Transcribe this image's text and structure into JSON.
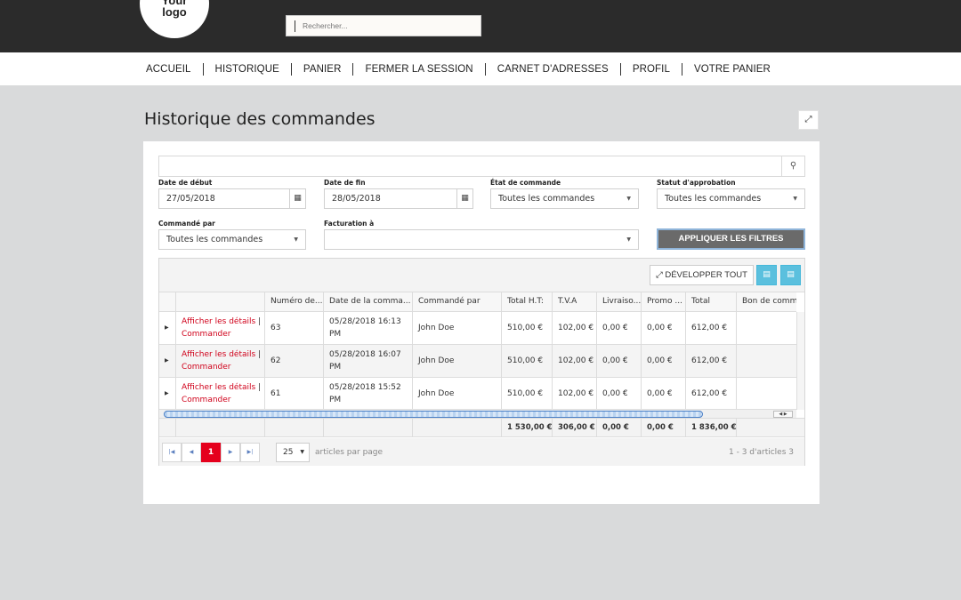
{
  "header": {
    "logo_line1": "Your",
    "logo_line2": "logo",
    "search_placeholder": "Rechercher..."
  },
  "nav": {
    "items": [
      "ACCUEIL",
      "HISTORIQUE",
      "PANIER",
      "FERMER LA SESSION",
      "CARNET D'ADRESSES",
      "PROFIL",
      "VOTRE PANIER"
    ]
  },
  "page": {
    "title": "Historique des commandes",
    "expand_icon": "⤢"
  },
  "filters": {
    "search_icon": "⚲",
    "start_label": "Date de début",
    "start_value": "27/05/2018",
    "end_label": "Date de fin",
    "end_value": "28/05/2018",
    "state_label": "État de commande",
    "state_value": "Toutes les commandes",
    "approval_label": "Statut d'approbation",
    "approval_value": "Toutes les commandes",
    "ordered_by_label": "Commandé par",
    "ordered_by_value": "Toutes les commandes",
    "billing_label": "Facturation à",
    "billing_value": "",
    "apply_label": "APPLIQUER LES FILTRES"
  },
  "grid": {
    "expand_all": "DÉVELOPPER TOUT",
    "columns": [
      "",
      "",
      "Numéro de...",
      "Date de la comma...",
      "Commandé par",
      "Total H.T:",
      "T.V.A",
      "Livraiso...",
      "Promo ...",
      "Total",
      "Bon de comm"
    ],
    "rows": [
      {
        "details": "Afficher les détails",
        "order": "Commander",
        "number": "63",
        "date": "05/28/2018 16:13 PM",
        "by": "John Doe",
        "ht": "510,00 €",
        "tva": "102,00 €",
        "ship": "0,00 €",
        "promo": "0,00 €",
        "total": "612,00 €",
        "po": ""
      },
      {
        "details": "Afficher les détails",
        "order": "Commander",
        "number": "62",
        "date": "05/28/2018 16:07 PM",
        "by": "John Doe",
        "ht": "510,00 €",
        "tva": "102,00 €",
        "ship": "0,00 €",
        "promo": "0,00 €",
        "total": "612,00 €",
        "po": ""
      },
      {
        "details": "Afficher les détails",
        "order": "Commander",
        "number": "61",
        "date": "05/28/2018 15:52 PM",
        "by": "John Doe",
        "ht": "510,00 €",
        "tva": "102,00 €",
        "ship": "0,00 €",
        "promo": "0,00 €",
        "total": "612,00 €",
        "po": ""
      }
    ],
    "footer": {
      "ht": "1 530,00 €",
      "tva": "306,00 €",
      "ship": "0,00 €",
      "promo": "0,00 €",
      "total": "1 836,00 €"
    }
  },
  "pager": {
    "current_page": "1",
    "page_size": "25",
    "per_page_label": "articles par page",
    "summary": "1 - 3 d'articles 3"
  }
}
